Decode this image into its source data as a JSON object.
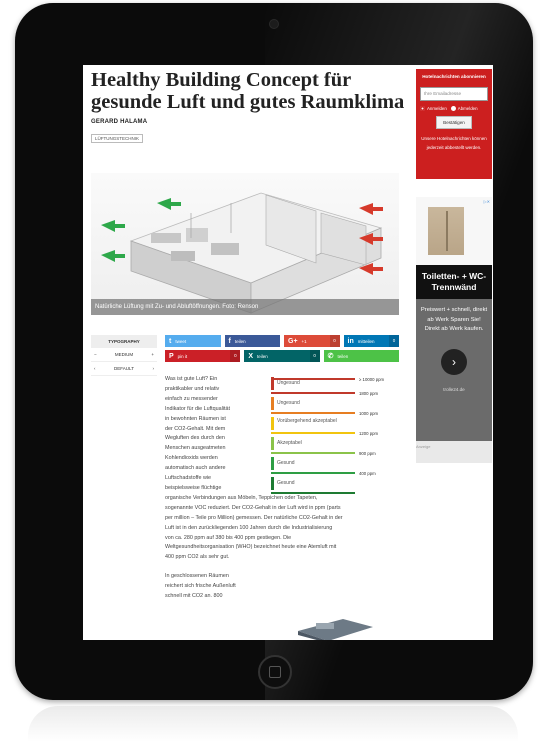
{
  "article": {
    "title": "Healthy Building Concept für gesunde Luft und gutes Raumklima",
    "author": "GERARD HALAMA",
    "tag": "LÜFTUNGSTECHNIK",
    "image_caption": "Natürliche Lüftung mit Zu- und Abluftöffnungen. Foto: Renson",
    "intro_lines": [
      "Was ist gute Luft? Ein",
      "praktikabler und relativ",
      "einfach zu messender",
      "Indikator für die Luftqualität",
      "in bewohnten Räumen ist",
      "der CO2-Gehalt. Mit dem",
      "Wegluften des durch den",
      "Menschen ausgeatmeten",
      "Kohlendioxids werden",
      "automatisch auch andere",
      "Luftschadstoffe wie",
      "beispielsweise flüchtige"
    ],
    "body_lines": [
      "organische Verbindungen aus Möbeln, Teppichen oder Tapeten,",
      "sogenannte VOC reduziert. Der CO2-Gehalt in der Luft wird in ppm (parts",
      "per million – Teile pro Million) gemessen. Der natürliche CO2-Gehalt in der",
      "Luft ist in den zurückliegenden 100 Jahren durch die Industrialisierung",
      "von ca. 280 ppm auf 380 bis 400 ppm gestiegen. Die",
      "Weltgesundheitsorganisation (WHO) bezeichnet heute eine Atemluft mit",
      "400 ppm CO2 als sehr gut."
    ],
    "second_paragraph_lines": [
      "In geschlossenen Räumen",
      "reichert sich frische Außenluft",
      "schnell mit CO2 an. 800"
    ]
  },
  "typography": {
    "header": "TYPOGRAPHY",
    "size_minus": "−",
    "size_label": "MEDIUM",
    "size_plus": "+",
    "font_prev": "‹",
    "font_label": "DEFAULT",
    "font_next": "›"
  },
  "share": {
    "tweet": "tweet",
    "facebook": "teilen",
    "gplus": "+1",
    "gplus_count": "0",
    "linkedin": "mitteilen",
    "linkedin_count": "0",
    "pinterest": "pin it",
    "pinterest_count": "0",
    "xing": "teilen",
    "xing_count": "0",
    "whatsapp": "teilen",
    "colors": {
      "twitter": "#55acee",
      "facebook": "#3b5998",
      "gplus": "#dd4b39",
      "linkedin": "#0077b5",
      "pinterest": "#cb2027",
      "xing": "#026466",
      "whatsapp": "#4dc247"
    }
  },
  "co2_scale": {
    "levels": [
      {
        "label": "Ungesund",
        "color": "#c0392b"
      },
      {
        "label": "Ungesund",
        "color": "#e67e22"
      },
      {
        "label": "Vorübergehend akzeptabel",
        "color": "#f1c40f"
      },
      {
        "label": "Akzeptabel",
        "color": "#8bc34a"
      },
      {
        "label": "Gesund",
        "color": "#2e9e44"
      },
      {
        "label": "Gesund",
        "color": "#1e7b32"
      }
    ],
    "ppm_labels": [
      "≥ 10000 ppm",
      "1800 ppm",
      "1000 ppm",
      "1200 ppm",
      "900 ppm",
      "400 ppm"
    ]
  },
  "newsletter": {
    "title": "Hotelnachrichten abonnieren",
    "email_placeholder": "Ihre Emailadresse",
    "subscribe": "Anmelden",
    "unsubscribe": "Abmelden",
    "confirm": "Bestätigen",
    "note": "Unsere Hotelnachrichten können jederzeit abbestellt werden."
  },
  "ad": {
    "choices": "▷✕",
    "title": "Toiletten- + WC-Trennwänd",
    "body": "Preiswert + schnell, direkt ab Werk Sparen Sie! Direkt ab Werk kaufen.",
    "arrow": "›",
    "url": "trolle24.de",
    "label": "Anzeige"
  }
}
